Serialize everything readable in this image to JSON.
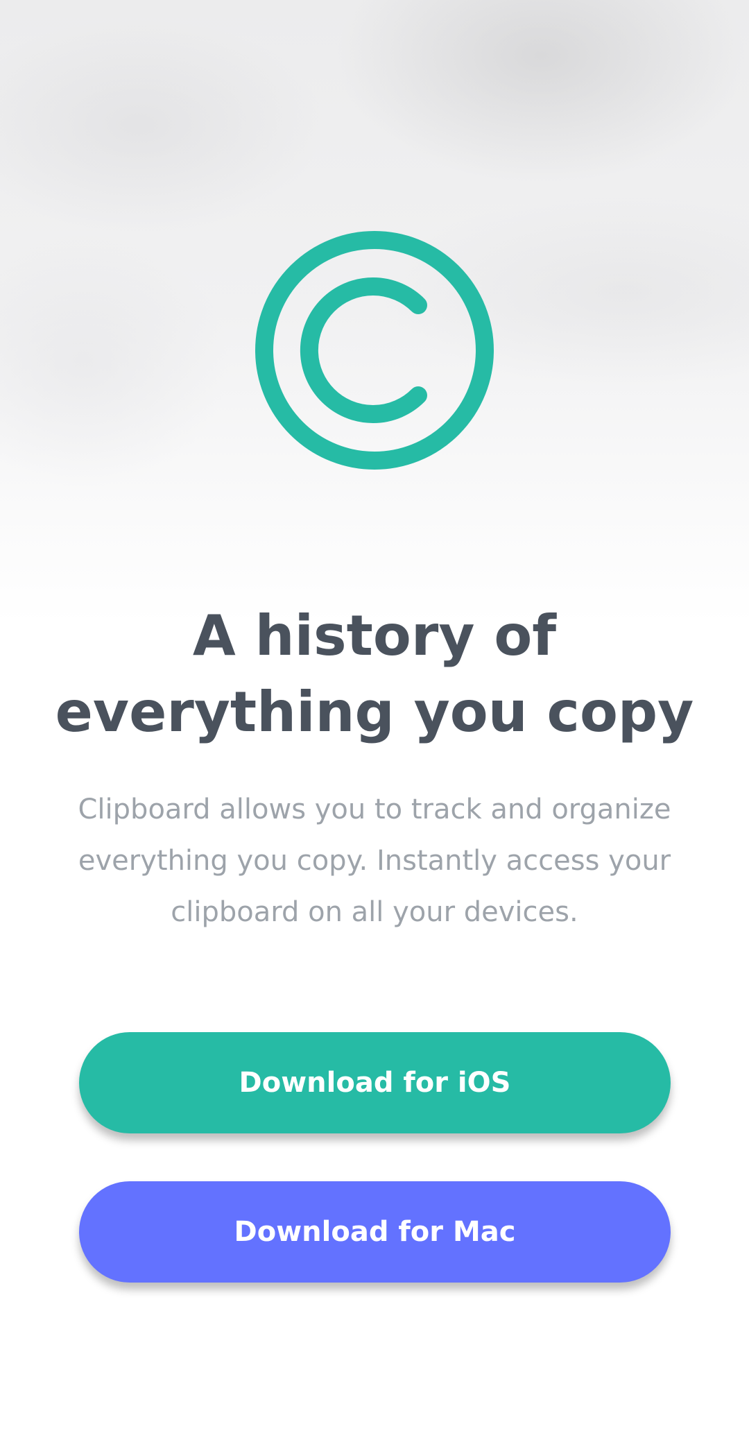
{
  "hero": {
    "logo_icon": "copyright-circle-icon",
    "headline_line1": "A history of",
    "headline_line2": "everything you copy",
    "description_line1": "Clipboard allows you to track and organize",
    "description_line2": "everything you copy. Instantly access your",
    "description_line3": "clipboard on all your devices."
  },
  "actions": {
    "ios_label": "Download for iOS",
    "mac_label": "Download for Mac"
  },
  "colors": {
    "accent_green": "#26bba5",
    "accent_blue": "#6372ff",
    "heading": "#4a525d",
    "body_text": "#9da3aa"
  }
}
